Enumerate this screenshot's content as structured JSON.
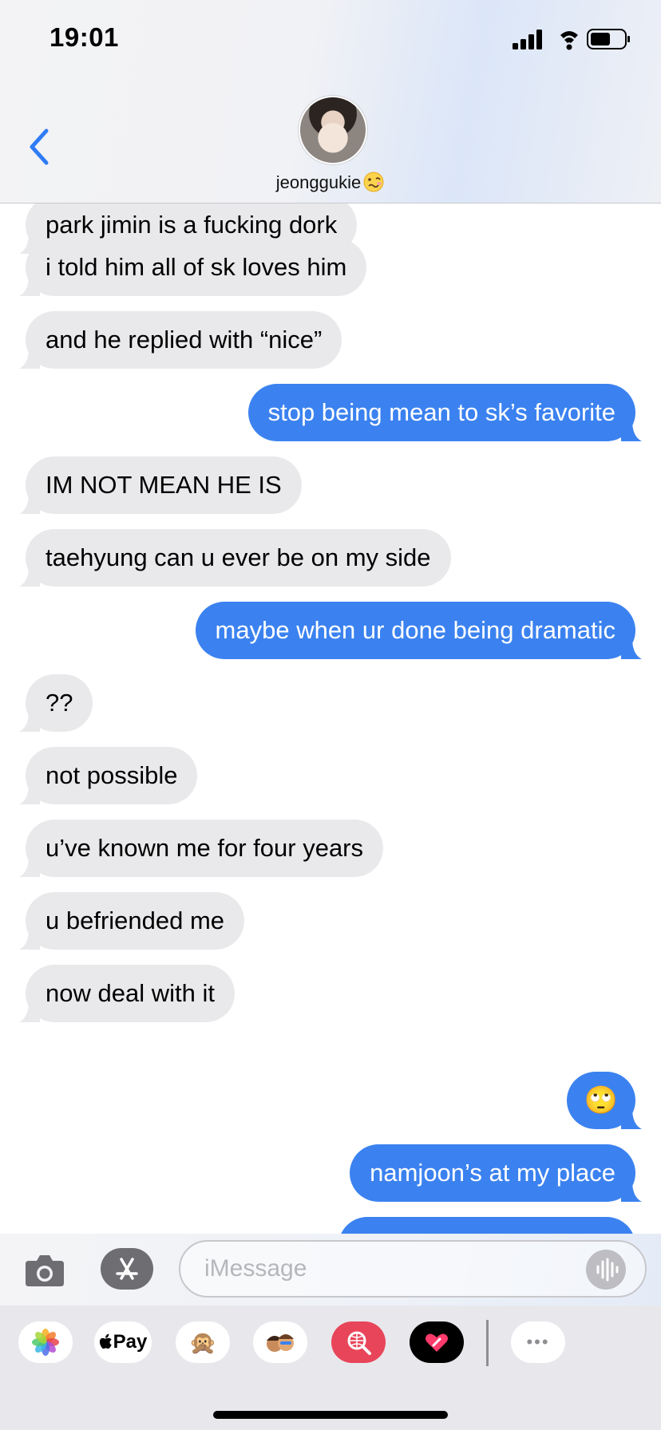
{
  "status_bar": {
    "time": "19:01"
  },
  "contact": {
    "name": "jeonggukie"
  },
  "messages": [
    {
      "direction": "incoming",
      "text": "park jimin is a fucking dork"
    },
    {
      "direction": "incoming",
      "text": "i told him all of sk loves him"
    },
    {
      "direction": "incoming",
      "text": "and he replied with “nice”"
    },
    {
      "direction": "outgoing",
      "text": "stop being mean to sk’s favorite"
    },
    {
      "direction": "incoming",
      "text": "IM NOT MEAN HE IS"
    },
    {
      "direction": "incoming",
      "text": "taehyung can u ever be on my side"
    },
    {
      "direction": "outgoing",
      "text": "maybe when ur done being dramatic"
    },
    {
      "direction": "incoming",
      "text": "??"
    },
    {
      "direction": "incoming",
      "text": "not possible"
    },
    {
      "direction": "incoming",
      "text": "u’ve known me for four years"
    },
    {
      "direction": "incoming",
      "text": "u befriended me"
    },
    {
      "direction": "incoming",
      "text": "now deal with it"
    },
    {
      "direction": "outgoing",
      "text": "🙄"
    },
    {
      "direction": "outgoing",
      "text": "namjoon’s at my place"
    }
  ],
  "input": {
    "placeholder": "iMessage"
  },
  "app_drawer": {
    "apple_pay_label": "Pay",
    "memoji_glyph": "🙊",
    "more_glyph": "•••"
  },
  "colors": {
    "outgoing": "#3b82f0",
    "incoming": "#e9e9eb",
    "accent": "#2f7cf6"
  }
}
